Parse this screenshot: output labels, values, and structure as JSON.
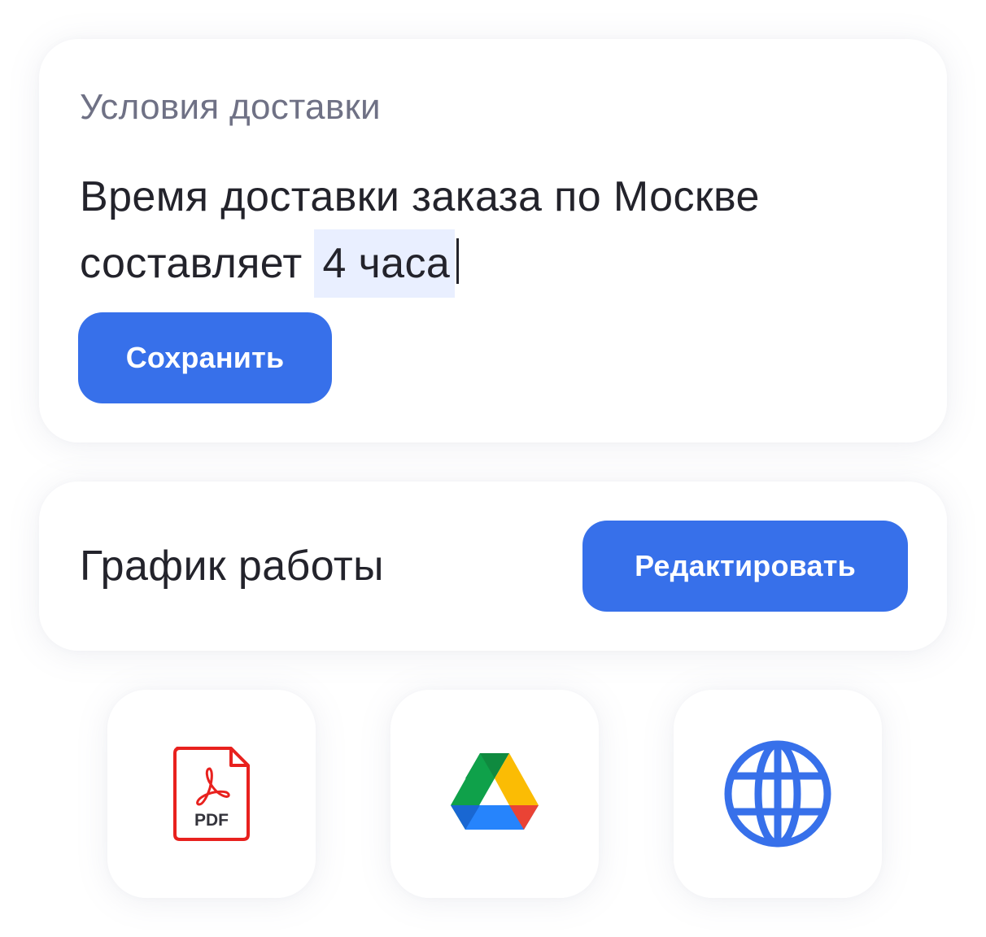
{
  "delivery": {
    "label": "Условия доставки",
    "text_line1": "Время доставки заказа по Москве",
    "text_line2_prefix": "составляет",
    "text_selected": "4 часа ",
    "save_label": "Сохранить"
  },
  "schedule": {
    "title": "График работы",
    "edit_label": "Редактировать"
  },
  "tiles": [
    {
      "icon": "pdf-icon",
      "label": "PDF"
    },
    {
      "icon": "google-drive-icon"
    },
    {
      "icon": "globe-icon"
    }
  ],
  "colors": {
    "accent": "#3770ea",
    "selection": "#e9efff",
    "text": "#23232b",
    "muted": "#6f7185",
    "pdf_red": "#e8211e"
  }
}
